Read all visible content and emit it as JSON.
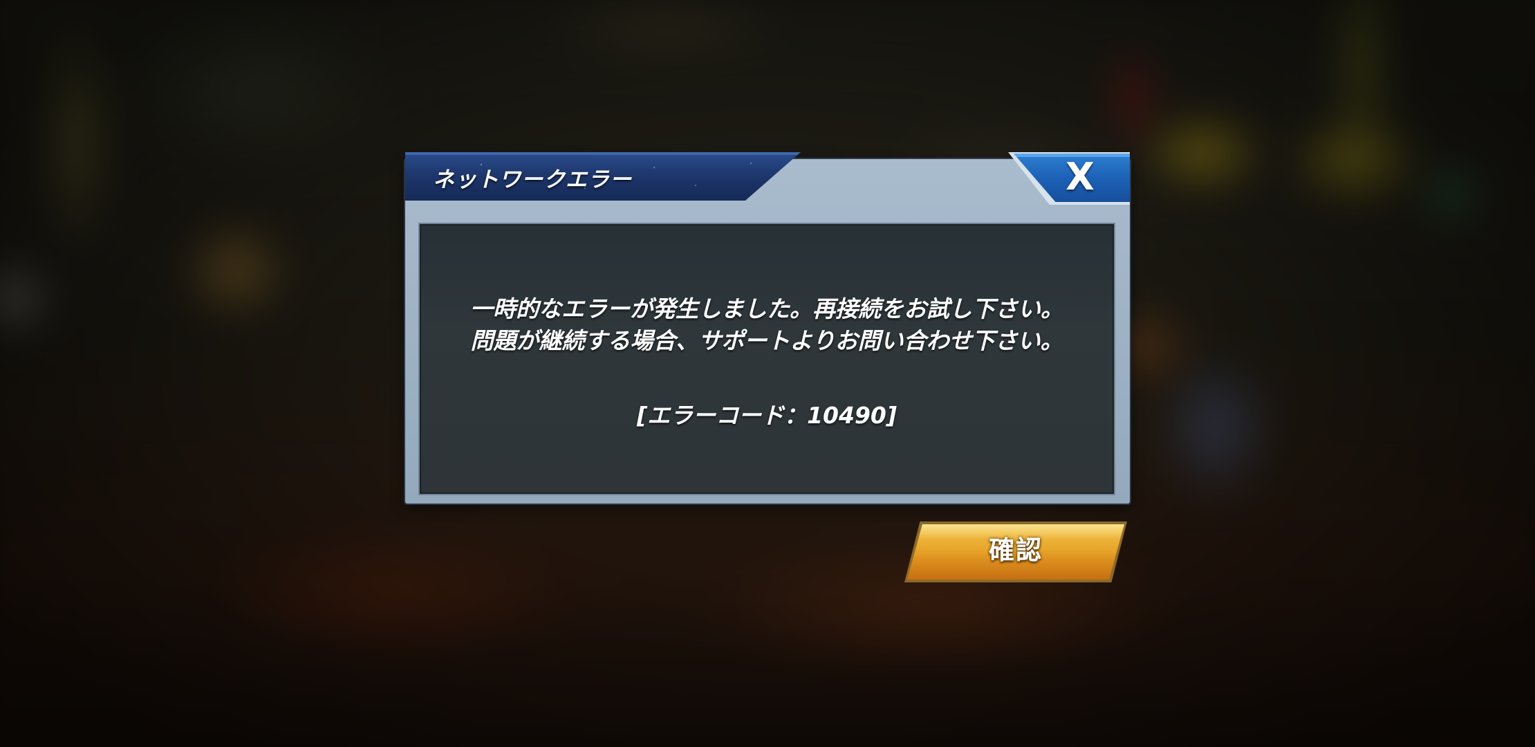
{
  "dialog": {
    "title": "ネットワークエラー",
    "close_icon": "X",
    "message_lines": [
      "一時的なエラーが発生しました。再接続をお試し下さい。",
      "問題が継続する場合、サポートよりお問い合わせ下さい。"
    ],
    "error_code": "[エラーコード：10490]",
    "confirm_label": "確認"
  },
  "colors": {
    "title_bar": "#1c3468",
    "close_button": "#1b5fb4",
    "frame": "#a9bccd",
    "content_panel": "#2f373b",
    "confirm_button": "#e8a72c",
    "text": "#ffffff"
  },
  "icons": {
    "close": "close-icon"
  }
}
